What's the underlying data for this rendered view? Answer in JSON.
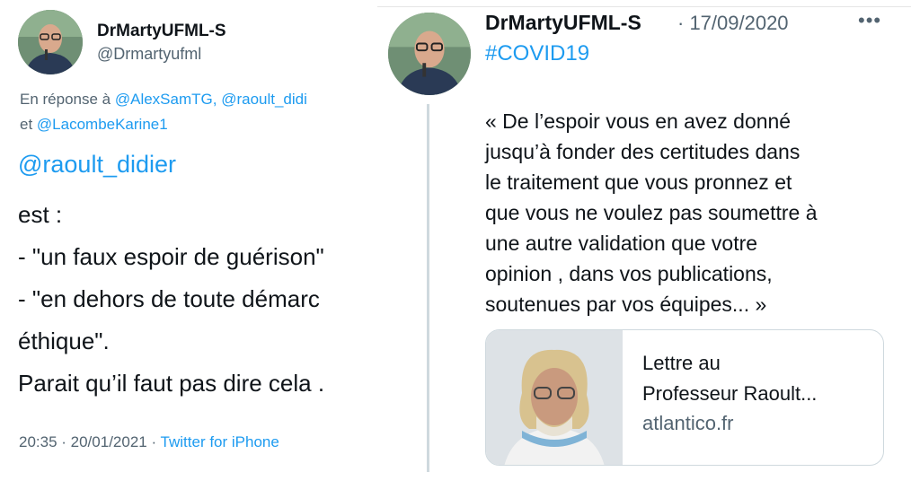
{
  "left_tweet": {
    "author_name": "DrMartyUFML-S",
    "author_handle": "@Drmartyufml",
    "reply_prefix": "En réponse à ",
    "reply_mentions_1": "@AlexSamTG, @raoult_didi",
    "reply_prefix_2": "et ",
    "reply_mentions_2": "@LacombeKarine1",
    "mention": "@raoult_didier",
    "lines": [
      "est :",
      "- \"un faux espoir de guérison\"",
      "- \"en dehors de toute démarc",
      "éthique\".",
      "Parait qu’il faut pas dire cela ."
    ],
    "time_date": "20:35 · 20/01/2021 · ",
    "source": "Twitter for iPhone"
  },
  "right_tweet": {
    "author_name": "DrMartyUFML-S",
    "date": "· 17/09/2020",
    "more_label": "•••",
    "hashtag": "#COVID19",
    "lines": [
      "« De l’espoir vous en avez donné",
      "jusqu’à fonder des certitudes dans",
      "le traitement que vous pronnez et",
      "que vous ne voulez pas soumettre à",
      "une autre validation que votre",
      "opinion , dans vos publications,",
      "soutenues par vos équipes... »"
    ],
    "card": {
      "title_line_1": "Lettre au",
      "title_line_2": "Professeur Raoult...",
      "domain": "atlantico.fr"
    }
  },
  "colors": {
    "link": "#1d9bf0",
    "muted": "#536471",
    "text": "#0f1419",
    "border": "#cfd9de"
  }
}
